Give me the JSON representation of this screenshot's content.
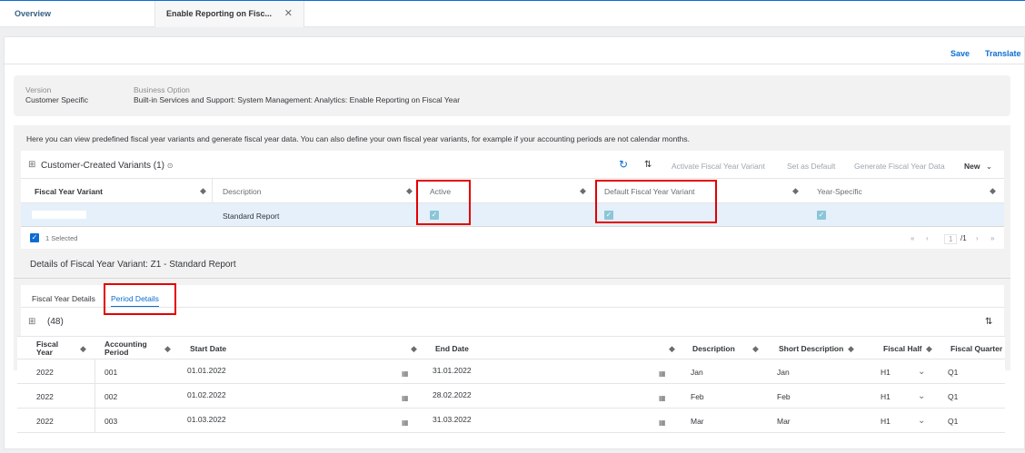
{
  "tabs": [
    {
      "label": "Overview"
    },
    {
      "label": "Enable Reporting on Fisc..."
    }
  ],
  "header_actions": {
    "save": "Save",
    "translate": "Translate"
  },
  "info": {
    "version_label": "Version",
    "version_value": "Customer Specific",
    "business_option_label": "Business Option",
    "business_option_value": "Built-in Services and Support: System Management: Analytics: Enable Reporting on Fiscal Year"
  },
  "intro_text": "Here you can view predefined fiscal year variants and generate fiscal year data. You can also define your own fiscal year variants, for example if your accounting periods are not calendar months.",
  "variants": {
    "title": "Customer-Created Variants",
    "count": "(1)",
    "actions": {
      "activate": "Activate Fiscal Year Variant",
      "set_default": "Set as Default",
      "generate": "Generate Fiscal Year Data",
      "new": "New"
    },
    "columns": [
      "Fiscal Year Variant",
      "Description",
      "Active",
      "Default Fiscal Year Variant",
      "Year-Specific"
    ],
    "row": {
      "description": "Standard Report",
      "active_check": "✓",
      "default_check": "✓",
      "year_specific_check": "✓"
    },
    "selected_count": "1 Selected",
    "selected_check": "✓",
    "pager": {
      "first": "«",
      "prev": "‹",
      "page": "1",
      "total": "/1",
      "next": "›",
      "last": "»"
    }
  },
  "details": {
    "title": "Details of Fiscal Year Variant: Z1 - Standard Report",
    "subtabs": [
      "Fiscal Year Details",
      "Period Details"
    ],
    "count": "(48)"
  },
  "periods": {
    "columns": [
      {
        "line1": "Fiscal",
        "line2": "Year"
      },
      {
        "line1": "Accounting",
        "line2": "Period"
      },
      {
        "line1": "Start Date",
        "line2": ""
      },
      {
        "line1": "End Date",
        "line2": ""
      },
      {
        "line1": "Description",
        "line2": ""
      },
      {
        "line1": "Short Description",
        "line2": ""
      },
      {
        "line1": "Fiscal Half",
        "line2": ""
      },
      {
        "line1": "Fiscal Quarter",
        "line2": ""
      }
    ],
    "rows": [
      {
        "year": "2022",
        "period": "001",
        "start": "01.01.2022",
        "end": "31.01.2022",
        "desc": "Jan",
        "short": "Jan",
        "half": "H1",
        "quarter": "Q1"
      },
      {
        "year": "2022",
        "period": "002",
        "start": "01.02.2022",
        "end": "28.02.2022",
        "desc": "Feb",
        "short": "Feb",
        "half": "H1",
        "quarter": "Q1"
      },
      {
        "year": "2022",
        "period": "003",
        "start": "01.03.2022",
        "end": "31.03.2022",
        "desc": "Mar",
        "short": "Mar",
        "half": "H1",
        "quarter": "Q1"
      }
    ]
  },
  "icons": {
    "close": "✕",
    "info": "⊙",
    "table": "⊞",
    "refresh": "↻",
    "sort": "⇅",
    "sort_arrow": "◆",
    "dropdown": "⌄",
    "calendar": "▦"
  },
  "colors": {
    "accent": "#0a6ed1",
    "highlight_box": "#e30000",
    "selected_row": "#e5f0fa"
  }
}
